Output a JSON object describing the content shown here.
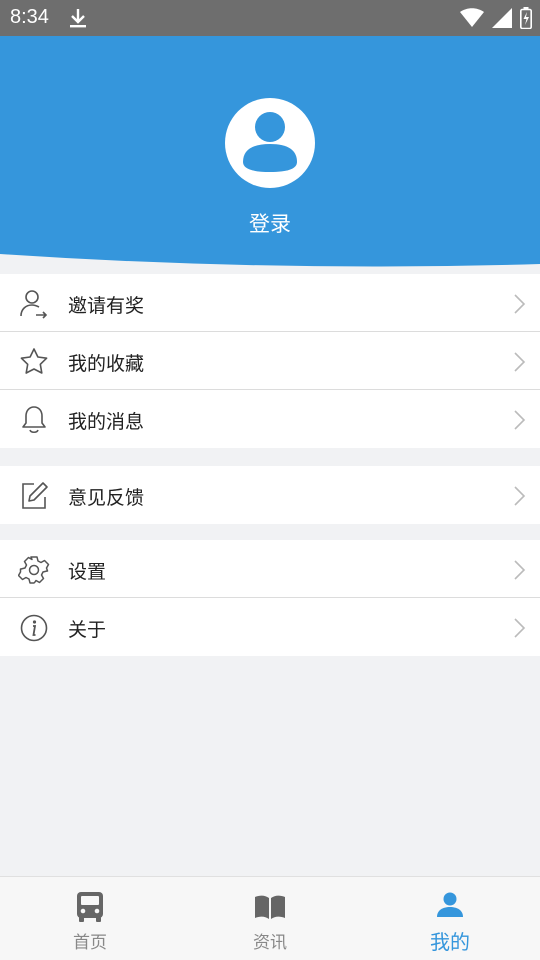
{
  "status_bar": {
    "time": "8:34"
  },
  "header": {
    "login_label": "登录"
  },
  "menu": {
    "group1": [
      {
        "label": "邀请有奖",
        "icon": "invite-user-icon"
      },
      {
        "label": "我的收藏",
        "icon": "star-icon"
      },
      {
        "label": "我的消息",
        "icon": "bell-icon"
      }
    ],
    "group2": [
      {
        "label": "意见反馈",
        "icon": "edit-icon"
      }
    ],
    "group3": [
      {
        "label": "设置",
        "icon": "gear-icon"
      },
      {
        "label": "关于",
        "icon": "info-icon"
      }
    ]
  },
  "tabbar": {
    "tabs": [
      {
        "label": "首页",
        "icon": "bus-icon",
        "active": false
      },
      {
        "label": "资讯",
        "icon": "book-icon",
        "active": false
      },
      {
        "label": "我的",
        "icon": "person-icon",
        "active": true
      }
    ]
  },
  "colors": {
    "brand": "#3596dc",
    "status_bar": "#6e6e6e",
    "background": "#f1f2f4"
  }
}
